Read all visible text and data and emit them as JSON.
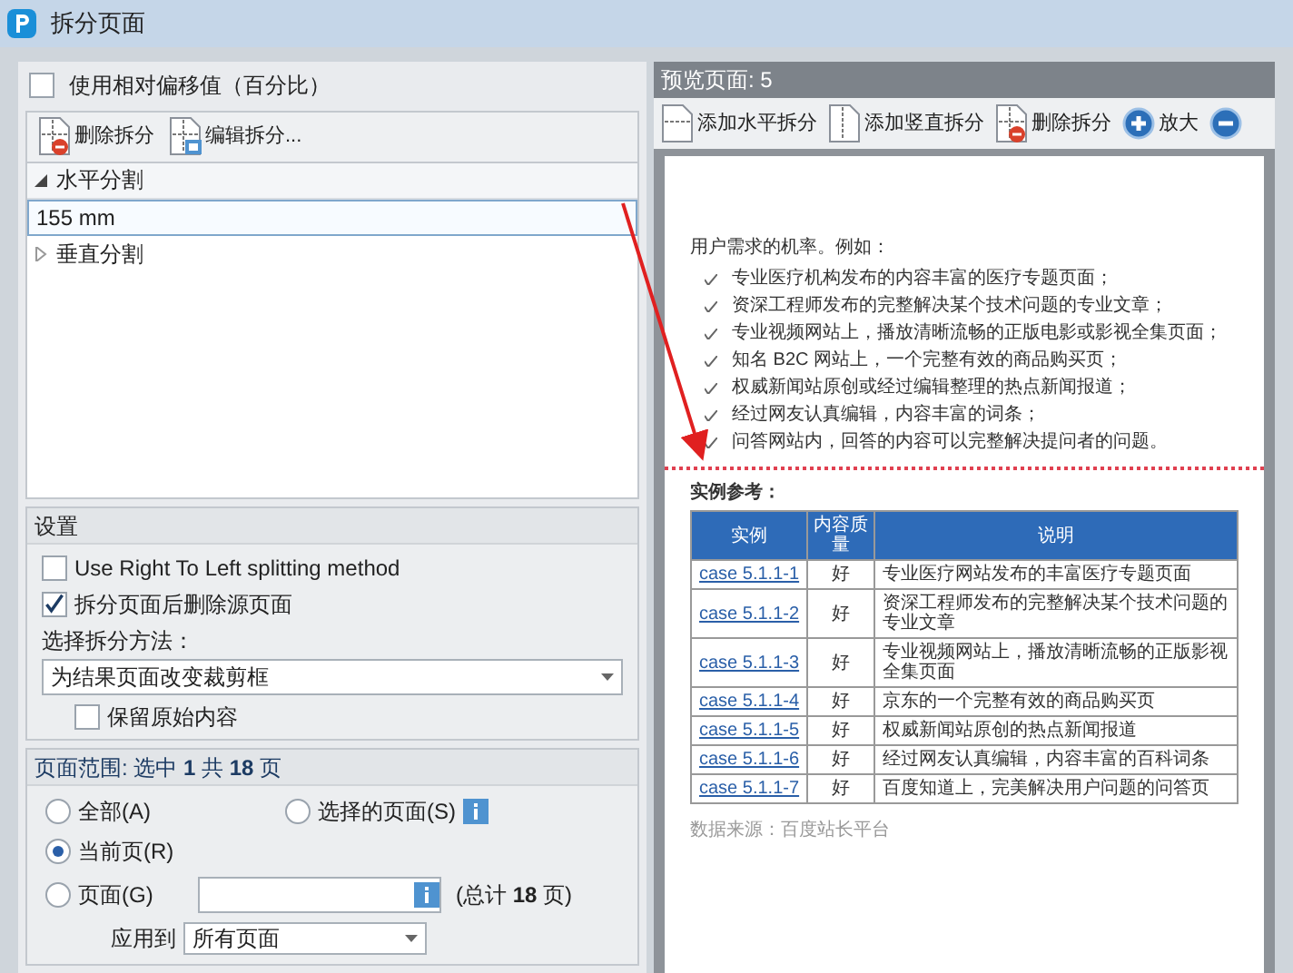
{
  "window": {
    "title": "拆分页面"
  },
  "relative_offset": {
    "label": "使用相对偏移值（百分比）",
    "checked": false
  },
  "split_toolbar": [
    {
      "kind": "delete",
      "label": "删除拆分"
    },
    {
      "kind": "edit",
      "label": "编辑拆分..."
    }
  ],
  "split_tree": [
    {
      "label": "水平分割",
      "expanded": true,
      "children": [
        {
          "value": "155 mm"
        }
      ]
    },
    {
      "label": "垂直分割",
      "expanded": false
    }
  ],
  "settings": {
    "title": "设置",
    "options": [
      {
        "label": "Use Right To Left splitting method",
        "checked": false
      },
      {
        "label": "拆分页面后删除源页面",
        "checked": true
      }
    ],
    "method_label": "选择拆分方法：",
    "method_value": "为结果页面改变裁剪框",
    "keep_original": {
      "label": "保留原始内容",
      "checked": false
    }
  },
  "page_range": {
    "title": "页面范围: 选中 **1** 共 **18** 页",
    "radios": [
      {
        "label": "全部(A)",
        "selected": false
      },
      {
        "label": "选择的页面(S)",
        "selected": false
      },
      {
        "label": "当前页(R)",
        "selected": true
      },
      {
        "label": "页面(G)",
        "selected": false
      }
    ],
    "pages_total": "(总计 **18** 页)",
    "apply_label": "应用到",
    "apply_value": "所有页面"
  },
  "preview": {
    "title": "预览页面: 5",
    "toolbar": [
      {
        "kind": "add-horizontal",
        "label": "添加水平拆分"
      },
      {
        "kind": "add-vertical",
        "label": "添加竖直拆分"
      },
      {
        "kind": "delete",
        "label": "删除拆分"
      },
      {
        "kind": "zoom-in",
        "label": "放大"
      },
      {
        "kind": "zoom-out"
      }
    ],
    "page": {
      "intro": "用户需求的机率。例如：",
      "bullets": [
        "专业医疗机构发布的内容丰富的医疗专题页面；",
        "资深工程师发布的完整解决某个技术问题的专业文章；",
        "专业视频网站上，播放清晰流畅的正版电影或影视全集页面；",
        "知名 B2C 网站上，一个完整有效的商品购买页；",
        "权威新闻站原创或经过编辑整理的热点新闻报道；",
        "经过网友认真编辑，内容丰富的词条；",
        "问答网站内，回答的内容可以完整解决提问者的问题。"
      ],
      "table_heading": "实例参考：",
      "columns": [
        "实例",
        "内容质量",
        "说明"
      ],
      "rows": [
        [
          "case 5.1.1-1",
          "好",
          "专业医疗网站发布的丰富医疗专题页面"
        ],
        [
          "case 5.1.1-2",
          "好",
          "资深工程师发布的完整解决某个技术问题的专业文章"
        ],
        [
          "case 5.1.1-3",
          "好",
          "专业视频网站上，播放清晰流畅的正版影视全集页面"
        ],
        [
          "case 5.1.1-4",
          "好",
          "京东的一个完整有效的商品购买页"
        ],
        [
          "case 5.1.1-5",
          "好",
          "权威新闻站原创的热点新闻报道"
        ],
        [
          "case 5.1.1-6",
          "好",
          "经过网友认真编辑，内容丰富的百科词条"
        ],
        [
          "case 5.1.1-7",
          "好",
          "百度知道上，完美解决用户问题的问答页"
        ]
      ],
      "source": "数据来源：百度站长平台"
    }
  }
}
